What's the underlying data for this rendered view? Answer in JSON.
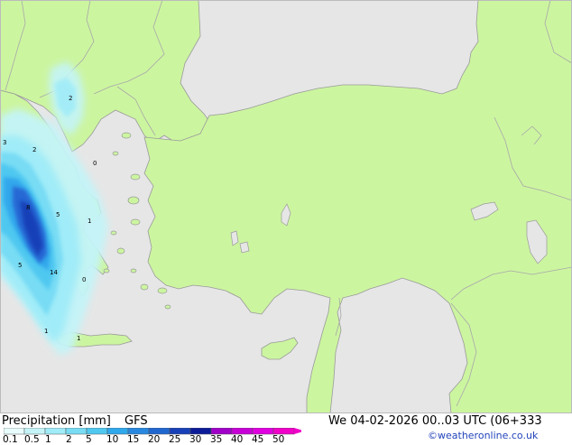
{
  "map": {
    "colors": {
      "sea": "#e6e6e6",
      "land": "#ccf5a0",
      "border": "#a8a8a8",
      "coast": "#9a9a9a"
    },
    "precip_labels": [
      "2",
      "3",
      "2",
      "0",
      "8",
      "5",
      "1",
      "5",
      "14",
      "0",
      "1",
      "1"
    ]
  },
  "footer": {
    "title": "Precipitation [mm]",
    "model": "GFS",
    "datetime": "We 04-02-2026 00..03 UTC (06+333",
    "credit": "©weatheronline.co.uk"
  },
  "legend": {
    "ticks": [
      "0.1",
      "0.5",
      "1",
      "2",
      "5",
      "10",
      "15",
      "20",
      "25",
      "30",
      "35",
      "40",
      "45",
      "50"
    ],
    "colors": [
      "#e8fcfc",
      "#c4f4f8",
      "#a0ecf8",
      "#78dcf4",
      "#50c8f0",
      "#30a8ec",
      "#2888e0",
      "#2068d0",
      "#1840b8",
      "#0c1c98",
      "#a000c8",
      "#c800d8",
      "#e000e0",
      "#f000c8"
    ]
  }
}
